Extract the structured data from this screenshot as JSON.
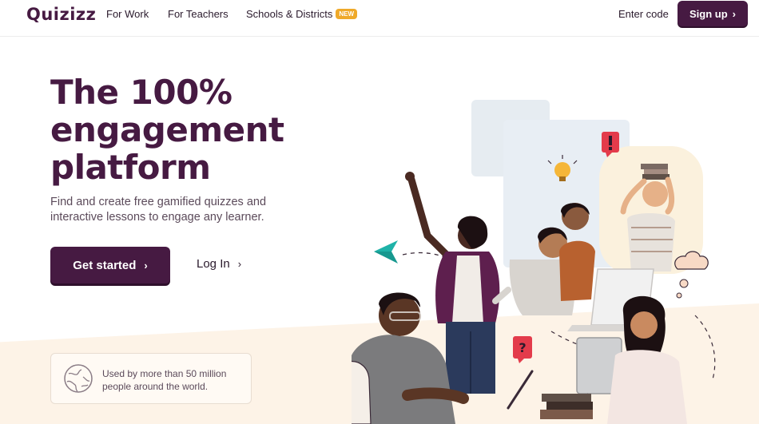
{
  "nav": {
    "logo": "Quizizz",
    "links": [
      {
        "label": "For Work"
      },
      {
        "label": "For Teachers"
      },
      {
        "label": "Schools & Districts"
      }
    ],
    "new_badge": "NEW",
    "enter_code": "Enter code",
    "signup": "Sign up"
  },
  "hero": {
    "headline": [
      "The 100%",
      "engagement",
      "platform"
    ],
    "subtext": "Find and create free gamified quizzes and interactive lessons to engage any learner.",
    "get_started": "Get started",
    "login": "Log In",
    "stats": "Used by more than 50 million people around the world."
  },
  "colors": {
    "brand": "#461a42",
    "badge": "#efa929",
    "accent_teal": "#1fb2a8",
    "accent_red": "#e33b4b"
  },
  "icons": [
    "chevron-right-icon",
    "globe-icon",
    "paper-plane-icon",
    "question-bubble-icon",
    "exclamation-bubble-icon",
    "lightbulb-icon",
    "cloud-doodle-icon"
  ]
}
